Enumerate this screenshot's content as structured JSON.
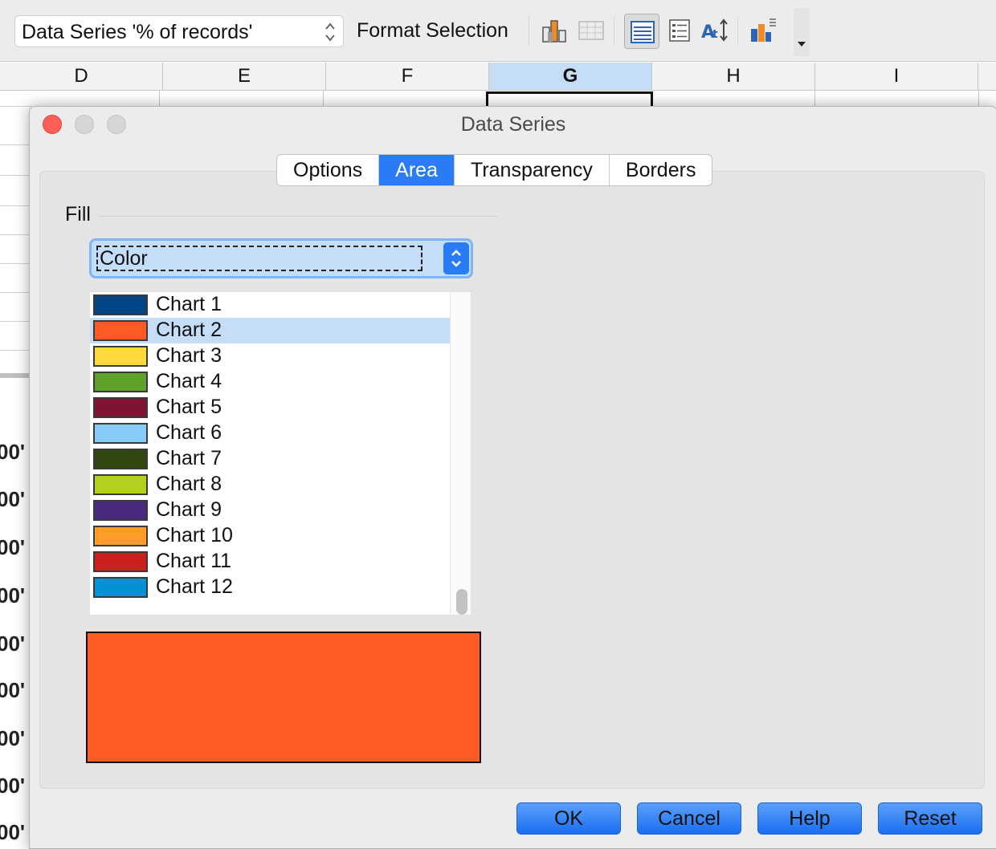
{
  "toolbar": {
    "element_select_value": "Data Series '% of records'",
    "format_selection_label": "Format Selection",
    "icons": [
      "chart-type-icon",
      "data-table-icon",
      "legend-on-off-icon",
      "legend-icon",
      "text-scale-icon",
      "chart-elements-icon",
      "more-options-icon"
    ]
  },
  "sheet": {
    "columns": [
      "D",
      "E",
      "F",
      "G",
      "H",
      "I"
    ],
    "selected_column": "G",
    "axis_partial_labels": [
      "00'",
      "00'",
      "00'",
      "00'",
      "00'",
      "00'",
      "00'",
      "00'",
      "00'"
    ]
  },
  "dialog": {
    "title": "Data Series",
    "tabs": [
      {
        "label": "Options",
        "active": false
      },
      {
        "label": "Area",
        "active": true
      },
      {
        "label": "Transparency",
        "active": false
      },
      {
        "label": "Borders",
        "active": false
      }
    ],
    "fill": {
      "section_label": "Fill",
      "type_value": "Color",
      "selected_color": "Chart 2",
      "preview_color": "#ff5a24",
      "colors": [
        {
          "name": "Chart 1",
          "hex": "#004586"
        },
        {
          "name": "Chart 2",
          "hex": "#ff5a24"
        },
        {
          "name": "Chart 3",
          "hex": "#ffd83a"
        },
        {
          "name": "Chart 4",
          "hex": "#5ea22c"
        },
        {
          "name": "Chart 5",
          "hex": "#7e1431"
        },
        {
          "name": "Chart 6",
          "hex": "#85ccfb"
        },
        {
          "name": "Chart 7",
          "hex": "#324811"
        },
        {
          "name": "Chart 8",
          "hex": "#b4cf1e"
        },
        {
          "name": "Chart 9",
          "hex": "#4a2a7e"
        },
        {
          "name": "Chart 10",
          "hex": "#ff9c2a"
        },
        {
          "name": "Chart 11",
          "hex": "#c9211e"
        },
        {
          "name": "Chart 12",
          "hex": "#0292d4"
        }
      ]
    },
    "buttons": {
      "ok": "OK",
      "cancel": "Cancel",
      "help": "Help",
      "reset": "Reset"
    }
  }
}
